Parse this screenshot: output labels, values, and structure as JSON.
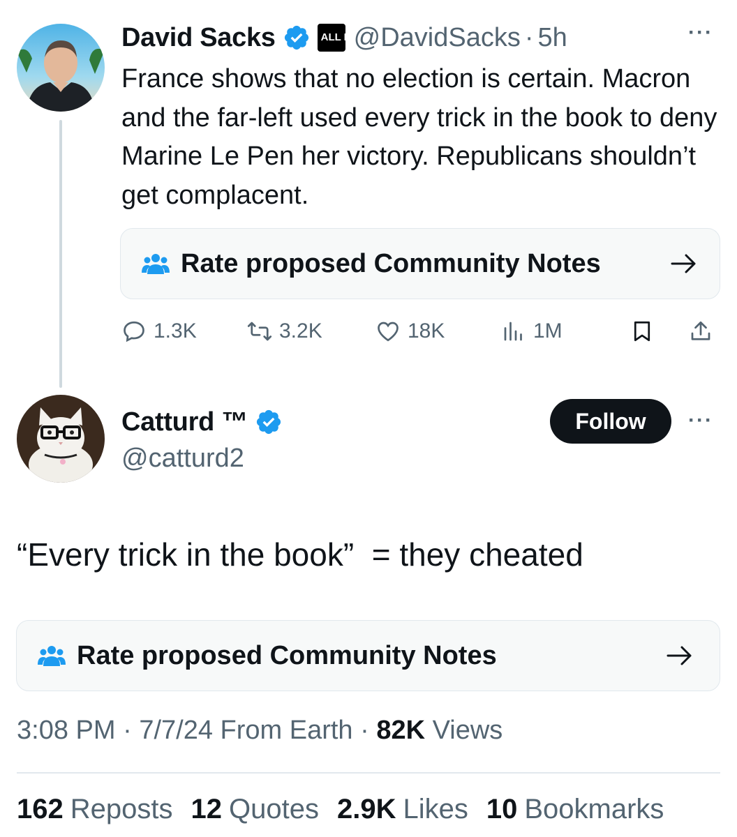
{
  "colors": {
    "text": "#0f1419",
    "muted": "#536471",
    "verified": "#1d9bf0",
    "notes_icon": "#1d9bf0",
    "follow_bg": "#0f1419"
  },
  "parent_tweet": {
    "author_name": "David Sacks",
    "affiliation_badge": "ALL IN",
    "handle": "@DavidSacks",
    "dot": "·",
    "time": "5h",
    "more": "···",
    "body": "France shows that no election is certain. Macron and the far-left used every trick in the book to deny Marine Le Pen her victory. Republicans shouldn’t get complacent.",
    "community_notes_label": "Rate proposed Community Notes",
    "actions": {
      "replies": "1.3K",
      "reposts": "3.2K",
      "likes": "18K",
      "views": "1M"
    }
  },
  "reply_tweet": {
    "author_name": "Catturd ™",
    "handle": "@catturd2",
    "follow_label": "Follow",
    "more": "···",
    "body": "“Every trick in the book”  = they cheated",
    "community_notes_label": "Rate proposed Community Notes",
    "meta": {
      "time": "3:08 PM",
      "sep1": " · ",
      "date_source": "7/7/24 From Earth",
      "sep2": " · ",
      "views_count": "82K",
      "views_label": " Views"
    },
    "stats": [
      {
        "count": "162",
        "label": "Reposts"
      },
      {
        "count": "12",
        "label": "Quotes"
      },
      {
        "count": "2.9K",
        "label": "Likes"
      },
      {
        "count": "10",
        "label": "Bookmarks"
      }
    ]
  }
}
